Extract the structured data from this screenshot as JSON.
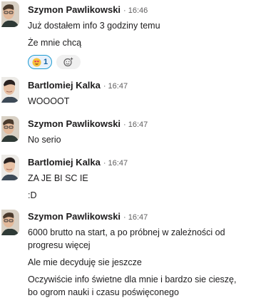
{
  "messages": [
    {
      "author": "Szymon Pawlikowski",
      "time": "16:46",
      "lines": [
        "Już dostałem info 3 godziny temu",
        "Że mnie chcą"
      ],
      "reactions": [
        {
          "emoji": "heart-eyes-emoji",
          "count": "1"
        }
      ]
    },
    {
      "author": "Bartlomiej Kalka",
      "time": "16:47",
      "lines": [
        "WOOOOT"
      ]
    },
    {
      "author": "Szymon Pawlikowski",
      "time": "16:47",
      "lines": [
        "No serio"
      ]
    },
    {
      "author": "Bartlomiej Kalka",
      "time": "16:47",
      "lines": [
        "ZA JE BI SC IE",
        ":D"
      ]
    },
    {
      "author": "Szymon Pawlikowski",
      "time": "16:47",
      "lines": [
        "6000 brutto na start, a po próbnej w zależności od",
        "progresu więcej",
        "Ale mie decyduję sie jeszcze",
        "Oczywiście info świetne dla mnie i bardzo sie cieszę,",
        "bo ogrom nauki i czasu poświęconego"
      ]
    }
  ],
  "separator": "·",
  "icons": {
    "add_reaction": "add-reaction-icon"
  },
  "colors": {
    "reaction_border": "#1d9bd1",
    "reaction_bg": "#e8f1fb",
    "reaction_count": "#1264a3",
    "meta_text": "#616061"
  }
}
